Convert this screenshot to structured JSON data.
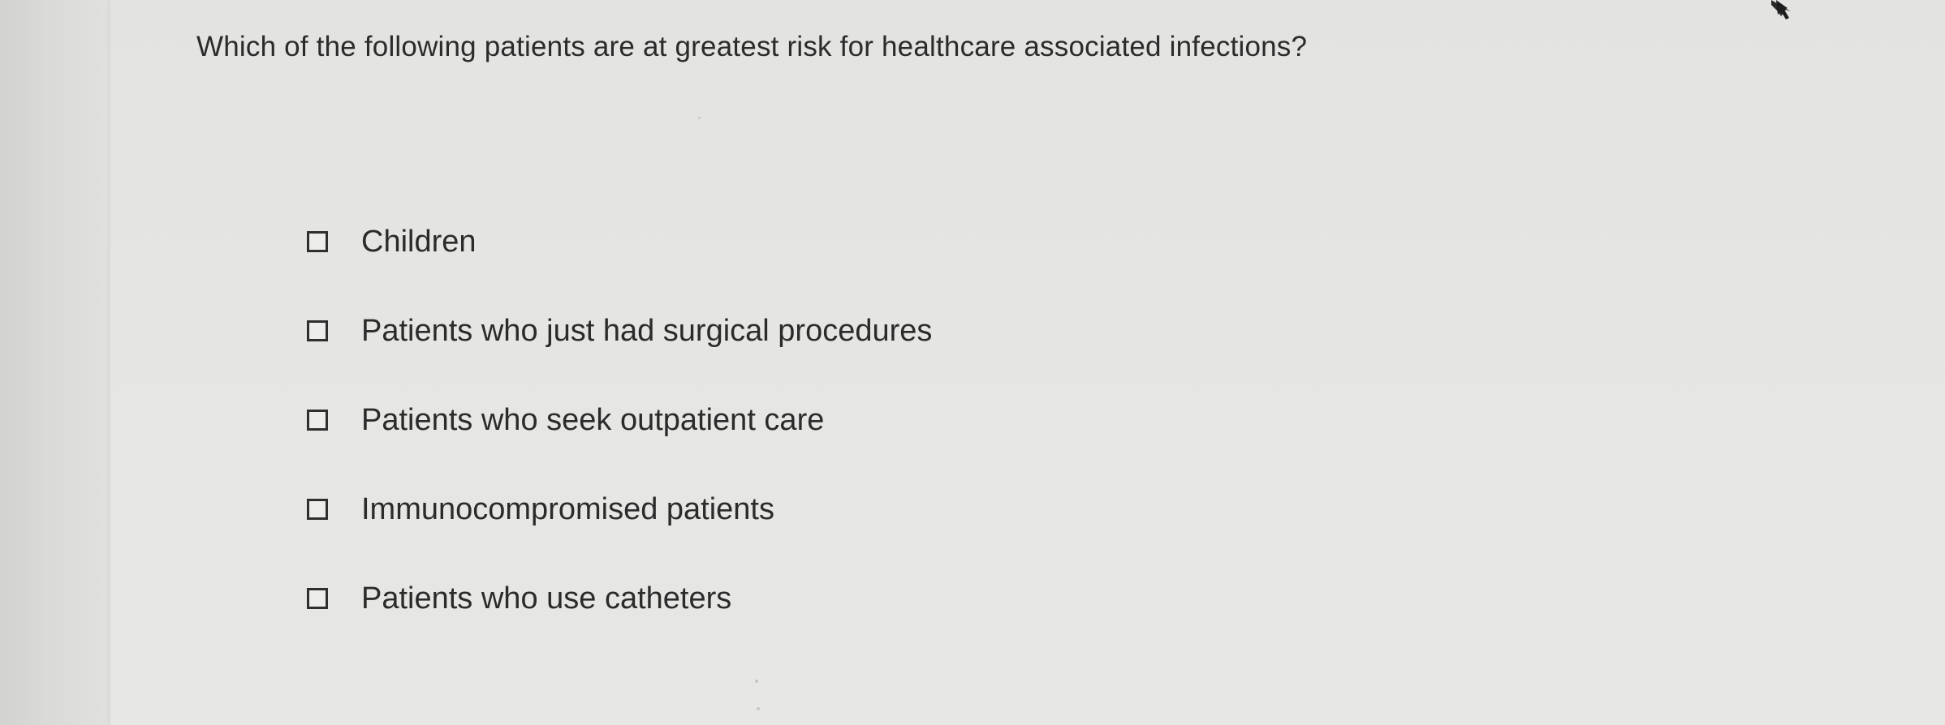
{
  "question": {
    "text": "Which of the following patients are at greatest risk for healthcare associated infections?"
  },
  "options": [
    {
      "label": "Children",
      "checked": false
    },
    {
      "label": "Patients who just had surgical procedures",
      "checked": false
    },
    {
      "label": "Patients who seek outpatient care",
      "checked": false
    },
    {
      "label": "Immunocompromised patients",
      "checked": false
    },
    {
      "label": "Patients who use catheters",
      "checked": false
    }
  ],
  "icons": {
    "cursor": "mouse-pointer-icon",
    "checkbox": "checkbox-unchecked-icon"
  },
  "colors": {
    "text": "#2b2b2b",
    "background": "#e6e6e4",
    "checkbox_border": "#2f2f2f"
  }
}
